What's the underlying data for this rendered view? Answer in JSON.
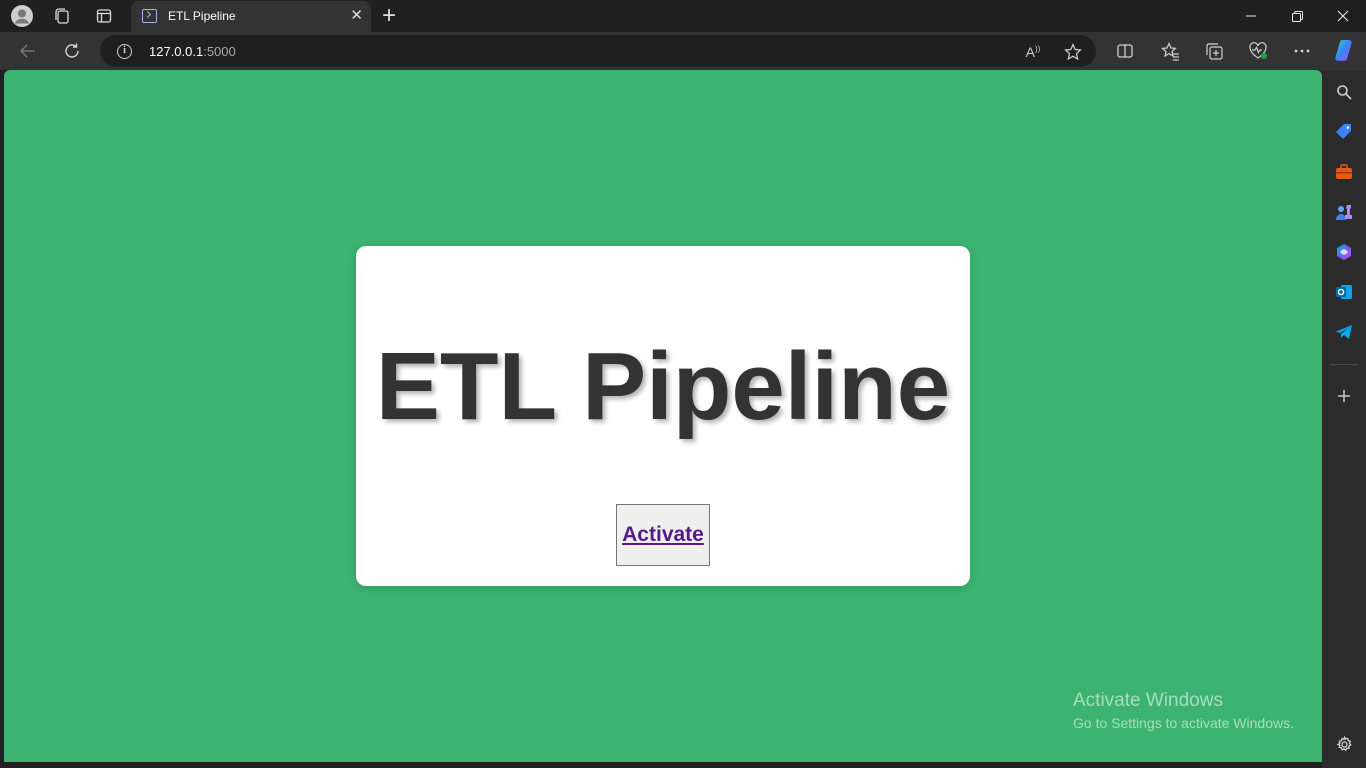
{
  "browser": {
    "tab": {
      "title": "ETL Pipeline"
    },
    "address": {
      "host": "127.0.0.1",
      "port": ":5000"
    }
  },
  "page": {
    "heading": "ETL Pipeline",
    "button_label": "Activate",
    "background_color": "#3cb371",
    "card_color": "#ffffff"
  },
  "watermark": {
    "title": "Activate Windows",
    "subtitle": "Go to Settings to activate Windows."
  }
}
